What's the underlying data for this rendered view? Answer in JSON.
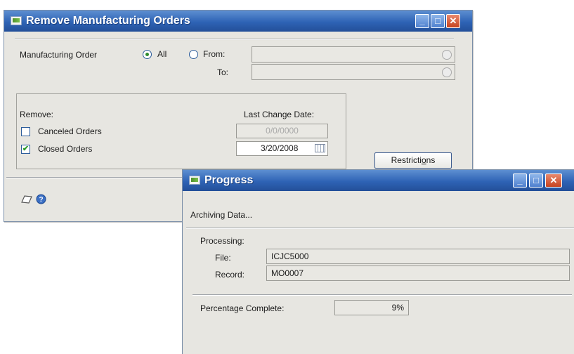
{
  "main_window": {
    "title": "Remove Manufacturing Orders",
    "manufacturing_order_label": "Manufacturing Order",
    "option_all": "All",
    "option_from": "From:",
    "to_label": "To:",
    "from_value": "",
    "to_value": "",
    "remove_label": "Remove:",
    "canceled_orders": "Canceled Orders",
    "closed_orders": "Closed Orders",
    "last_change_date_label": "Last Change Date:",
    "canceled_date": "0/0/0000",
    "closed_date": "3/20/2008",
    "restrictions_pre": "Restricti",
    "restrictions_accel": "o",
    "restrictions_post": "ns",
    "selected_option": "All",
    "canceled_checked": false,
    "closed_checked": true
  },
  "progress_window": {
    "title": "Progress",
    "status_text": "Archiving Data...",
    "processing_label": "Processing:",
    "file_label": "File:",
    "file_value": "ICJC5000",
    "record_label": "Record:",
    "record_value": "MO0007",
    "percentage_label": "Percentage Complete:",
    "percentage_value": "9%"
  },
  "icons": {
    "window_icon": "window-icon",
    "minimize": "minimize-icon",
    "maximize": "maximize-icon",
    "close": "close-icon",
    "note": "note-icon",
    "help": "help-icon",
    "lookup": "lookup-icon",
    "calendar": "calendar-icon"
  },
  "colors": {
    "title_bar": "#2e63b5",
    "window_body": "#e7e6e1",
    "close_button": "#c8431f",
    "check_mark": "#2b9b2b"
  }
}
